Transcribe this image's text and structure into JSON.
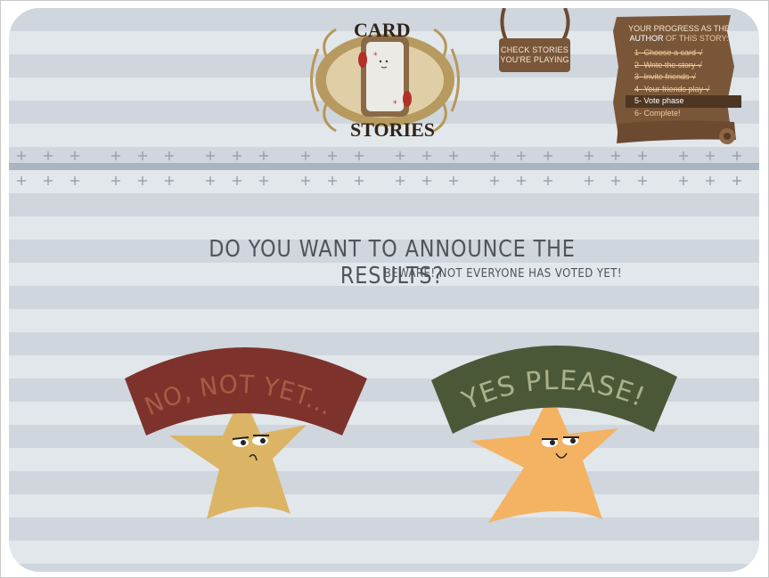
{
  "header": {
    "logo_text_top": "CARD",
    "logo_text_bottom": "STORIES",
    "check_stories_button": "CHECK STORIES YOU'RE PLAYING"
  },
  "progress": {
    "heading_part1": "YOUR PROGRESS AS THE",
    "heading_part2_strong": "AUTHOR",
    "heading_part2_rest": "OF THIS STORY:",
    "steps": [
      {
        "label": "1- Choose a card √",
        "state": "done"
      },
      {
        "label": "2- Write the story √",
        "state": "done"
      },
      {
        "label": "3- Invite friends √",
        "state": "done"
      },
      {
        "label": "4- Your friends play √",
        "state": "done"
      },
      {
        "label": "5- Vote phase",
        "state": "current"
      },
      {
        "label": "6- Complete!",
        "state": "future"
      }
    ]
  },
  "main": {
    "question": "DO YOU WANT TO ANNOUNCE THE RESULTS?",
    "warning": "BEWARE! NOT EVERYONE HAS VOTED YET!",
    "no_button_label": "NO, NOT YET...",
    "yes_button_label": "YES PLEASE!"
  },
  "colors": {
    "no_banner": "#7d332c",
    "yes_banner": "#4b5838",
    "no_star": "#dbb565",
    "yes_star": "#f3b363",
    "wood": "#7a5639"
  },
  "icons": {
    "cross": "cross-icon",
    "scroll_curl": "scroll-curl-icon"
  }
}
